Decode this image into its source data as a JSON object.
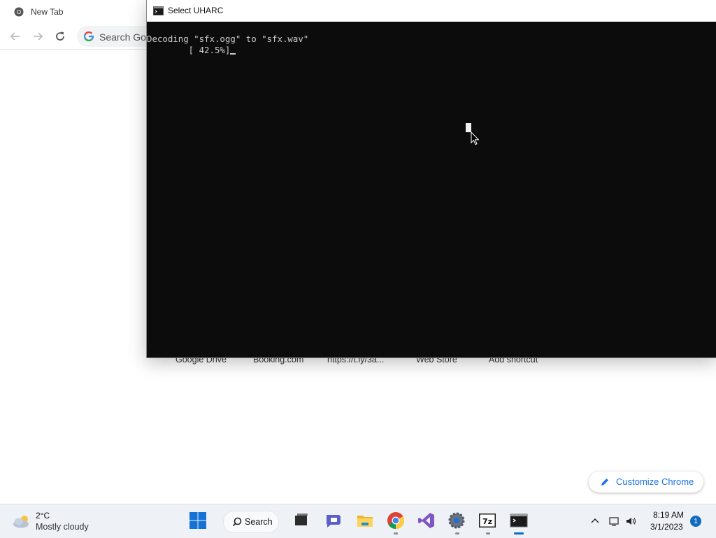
{
  "chrome": {
    "tab_title": "New Tab",
    "omnibox_placeholder": "Search Goo",
    "shortcuts": [
      "Google Drive",
      "Booking.com",
      "https://t.ly/3a...",
      "Web Store",
      "Add shortcut"
    ],
    "customize_label": "Customize Chrome"
  },
  "console": {
    "title": "Select UHARC",
    "lines": [
      "Decoding \"sfx.ogg\" to \"sfx.wav\"",
      "        [ 42.5%]"
    ],
    "progress_percent": 42.5
  },
  "taskbar": {
    "weather_temp": "2°C",
    "weather_desc": "Mostly cloudy",
    "search_label": "Search",
    "icons": [
      "windows-start-icon",
      "search-icon",
      "task-view-icon",
      "teams-chat-icon",
      "file-explorer-icon",
      "chrome-icon",
      "visual-studio-icon",
      "settings-icon",
      "7zip-icon",
      "terminal-icon"
    ],
    "clock_time": "8:19 AM",
    "clock_date": "3/1/2023",
    "notification_count": "1"
  },
  "colors": {
    "console_bg": "#0c0c0c",
    "console_text": "#cccccc",
    "accent": "#0f6cbd",
    "chrome_link": "#1a73e8"
  }
}
